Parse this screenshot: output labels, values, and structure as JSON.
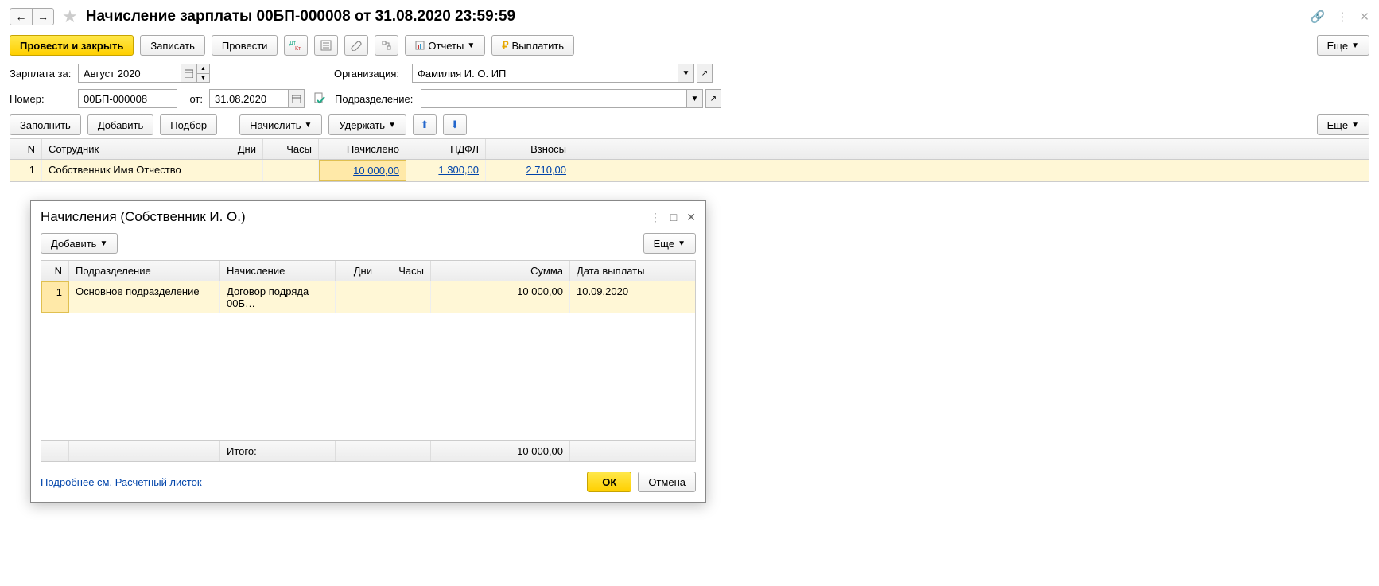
{
  "header": {
    "title": "Начисление зарплаты 00БП-000008 от 31.08.2020 23:59:59"
  },
  "toolbar": {
    "post_close": "Провести и закрыть",
    "write": "Записать",
    "post": "Провести",
    "reports": "Отчеты",
    "payout": "Выплатить",
    "more": "Еще"
  },
  "form": {
    "salary_for_label": "Зарплата за:",
    "salary_for_value": "Август 2020",
    "org_label": "Организация:",
    "org_value": "Фамилия И. О. ИП",
    "number_label": "Номер:",
    "number_value": "00БП-000008",
    "from_label": "от:",
    "from_value": "31.08.2020",
    "dept_label": "Подразделение:",
    "dept_value": ""
  },
  "subtoolbar": {
    "fill": "Заполнить",
    "add": "Добавить",
    "pick": "Подбор",
    "accrue": "Начислить",
    "withhold": "Удержать",
    "more": "Еще"
  },
  "main_table": {
    "headers": {
      "n": "N",
      "emp": "Сотрудник",
      "days": "Дни",
      "hours": "Часы",
      "accrued": "Начислено",
      "ndfl": "НДФЛ",
      "contrib": "Взносы"
    },
    "rows": [
      {
        "n": "1",
        "emp": "Собственник Имя Отчество",
        "days": "",
        "hours": "",
        "accrued": "10 000,00",
        "ndfl": "1 300,00",
        "contrib": "2 710,00"
      }
    ]
  },
  "modal": {
    "title": "Начисления (Собственник И. О.)",
    "add": "Добавить",
    "more": "Еще",
    "headers": {
      "n": "N",
      "dept": "Подразделение",
      "accrual": "Начисление",
      "days": "Дни",
      "hours": "Часы",
      "sum": "Сумма",
      "paydate": "Дата выплаты"
    },
    "rows": [
      {
        "n": "1",
        "dept": "Основное подразделение",
        "accrual": "Договор подряда 00Б…",
        "days": "",
        "hours": "",
        "sum": "10 000,00",
        "paydate": "10.09.2020"
      }
    ],
    "total_label": "Итого:",
    "total_value": "10 000,00",
    "details_link": "Подробнее см. Расчетный листок",
    "ok": "ОК",
    "cancel": "Отмена"
  }
}
